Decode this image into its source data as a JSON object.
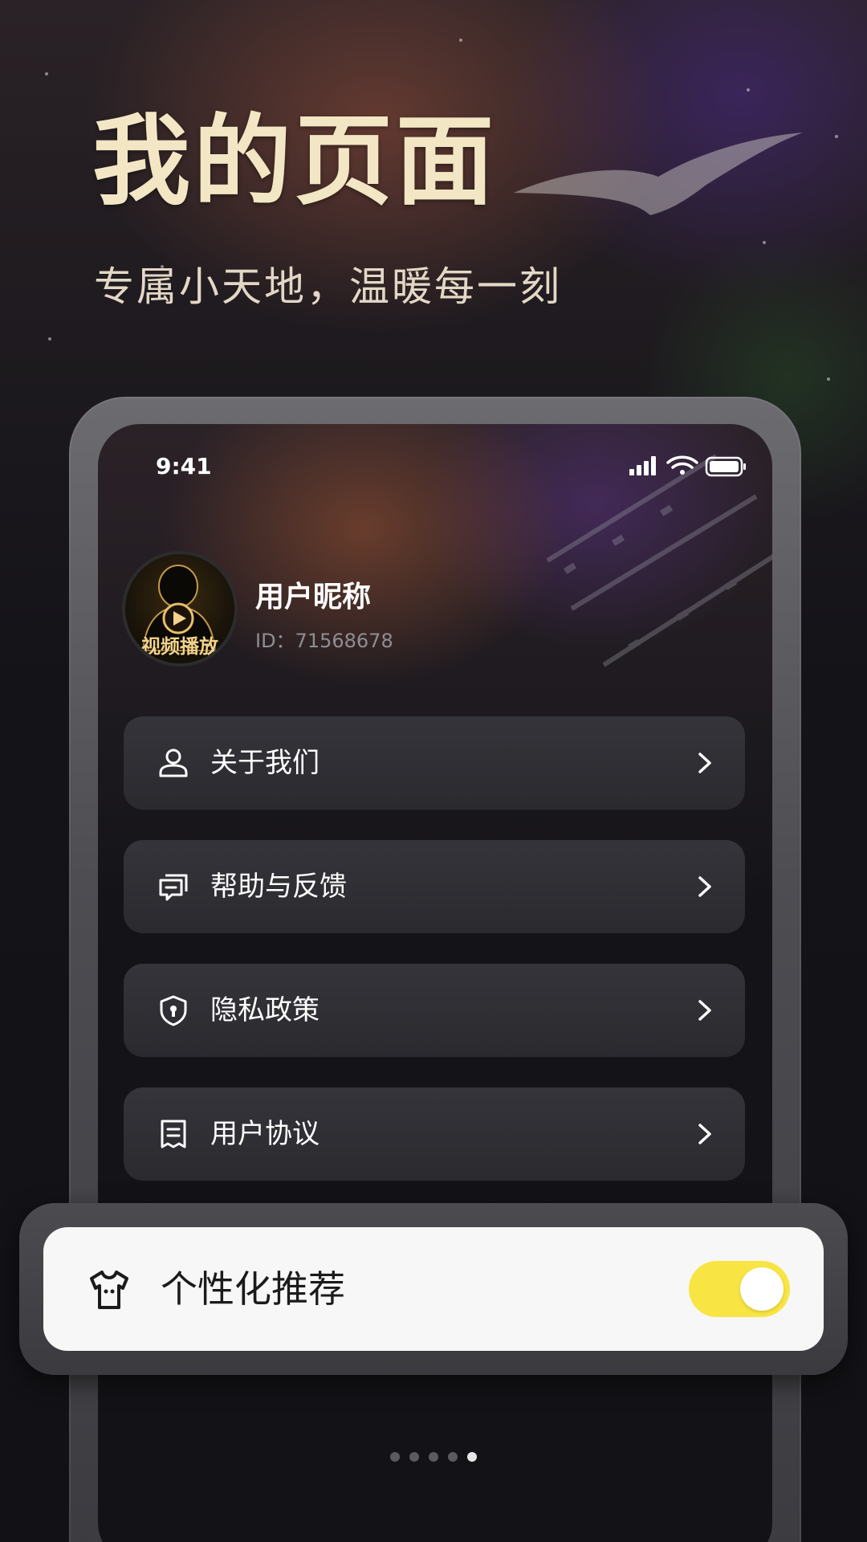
{
  "hero": {
    "title": "我的页面",
    "subtitle": "专属小天地，温暖每一刻"
  },
  "status_bar": {
    "time": "9:41"
  },
  "profile": {
    "nickname": "用户昵称",
    "id_text": "ID：71568678",
    "avatar_caption": "视频播放"
  },
  "menu": [
    {
      "label": "关于我们",
      "icon": "person-icon"
    },
    {
      "label": "帮助与反馈",
      "icon": "feedback-icon"
    },
    {
      "label": "隐私政策",
      "icon": "shield-icon"
    },
    {
      "label": "用户协议",
      "icon": "document-icon"
    }
  ],
  "feature_card": {
    "label": "个性化推荐",
    "icon": "tshirt-icon",
    "toggle_on": true
  },
  "pager": {
    "count": 5,
    "active_index": 4
  },
  "colors": {
    "hero_title": "#f3e6c4",
    "toggle_on": "#f8e543",
    "menu_bg": "#2e2e33",
    "screen_bg": "#131317"
  }
}
